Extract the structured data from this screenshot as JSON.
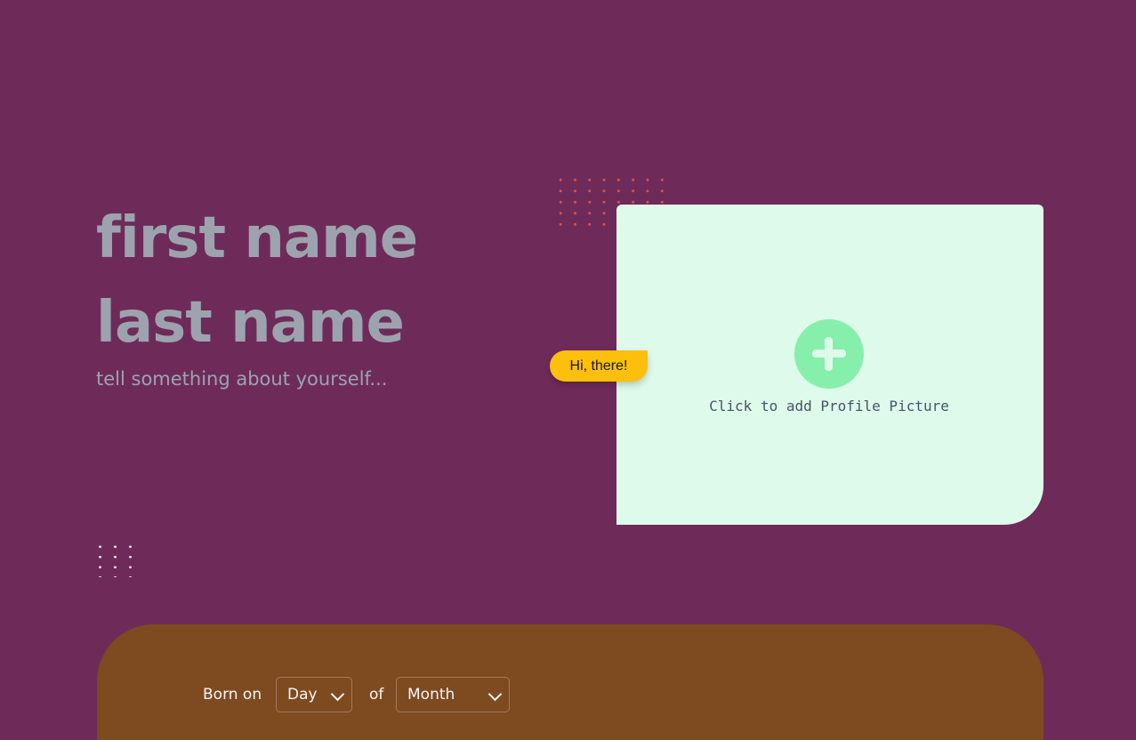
{
  "profile": {
    "first_name_placeholder": "first name",
    "last_name_placeholder": "last name",
    "bio_placeholder": "tell something about yourself..."
  },
  "picture": {
    "caption": "Click to add Profile Picture",
    "icon": "plus-icon",
    "accent": "#86efac",
    "card_color": "#defaea"
  },
  "greeting": {
    "text": "Hi, there!",
    "color": "#fbbf0c"
  },
  "birthday": {
    "born_label": "Born on",
    "of_label": "of",
    "day_value": "Day",
    "month_value": "Month",
    "panel_color": "#7e4a1f"
  },
  "theme": {
    "background": "#6e2b5a",
    "text_muted": "#9ca3af"
  }
}
